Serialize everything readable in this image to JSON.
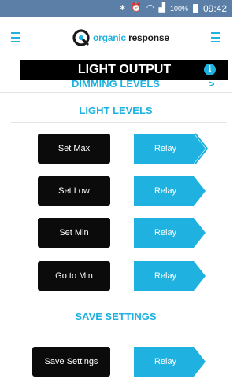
{
  "status_bar": {
    "icons": [
      "bluetooth-icon",
      "alarm-icon",
      "wifi-icon",
      "signal-icon"
    ],
    "battery_percent": "100%",
    "time": "09:42"
  },
  "header": {
    "logo_prefix": "organic",
    "logo_suffix": "response",
    "brand_color": "#1fb2e0"
  },
  "title_bar": {
    "title": "LIGHT OUTPUT",
    "info_glyph": "i"
  },
  "sections": {
    "dimming": {
      "label": "DIMMING LEVELS",
      "chevron": ">"
    },
    "light_levels": {
      "label": "LIGHT LEVELS"
    },
    "save_settings": {
      "label": "SAVE SETTINGS"
    }
  },
  "rows": [
    {
      "action": "Set Max",
      "relay": "Relay"
    },
    {
      "action": "Set Low",
      "relay": "Relay"
    },
    {
      "action": "Set Min",
      "relay": "Relay"
    },
    {
      "action": "Go to Min",
      "relay": "Relay"
    },
    {
      "action": "Save Settings",
      "relay": "Relay"
    }
  ],
  "colors": {
    "status_bar": "#5b7fa6",
    "accent": "#1fb2e0",
    "button": "#0b0b0b",
    "relay": "#1fb2e0"
  }
}
